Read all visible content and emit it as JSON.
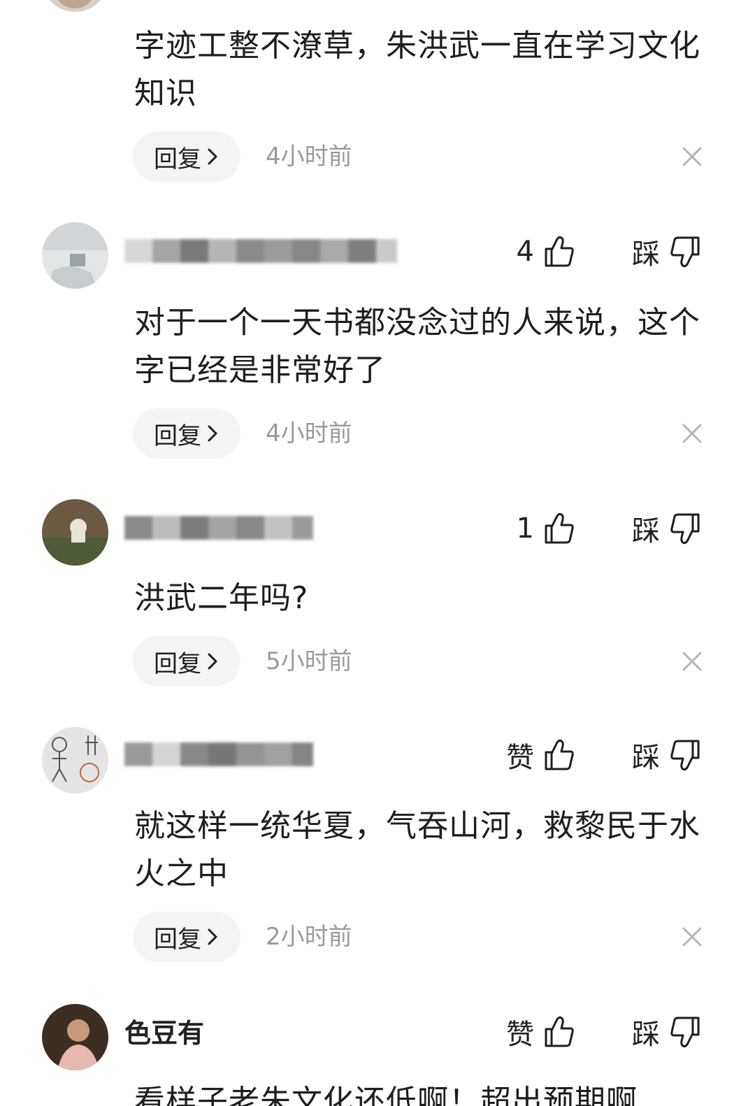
{
  "comments": [
    {
      "text": "字迹工整不潦草，朱洪武一直在学习文化知识",
      "reply_label": "回复",
      "time": "4小时前"
    },
    {
      "likes": "4",
      "dislike_label": "踩",
      "text": "对于一个一天书都没念过的人来说，这个字已经是非常好了",
      "reply_label": "回复",
      "time": "4小时前"
    },
    {
      "likes": "1",
      "dislike_label": "踩",
      "text": "洪武二年吗?",
      "reply_label": "回复",
      "time": "5小时前"
    },
    {
      "likes": "赞",
      "dislike_label": "踩",
      "text": "就这样一统华夏，气吞山河，救黎民于水火之中",
      "reply_label": "回复",
      "time": "2小时前"
    },
    {
      "username": "色豆有",
      "likes": "赞",
      "dislike_label": "踩",
      "text": "看样子老朱文化还低啊！超出预期啊"
    }
  ],
  "icons": {
    "like": "thumbs-up-icon",
    "dislike": "thumbs-down-icon",
    "reply_chevron": "chevron-right-icon",
    "close": "close-icon"
  },
  "colors": {
    "text": "#1e1e1e",
    "muted": "#9a9a9a",
    "pill_bg": "#f4f4f4"
  }
}
